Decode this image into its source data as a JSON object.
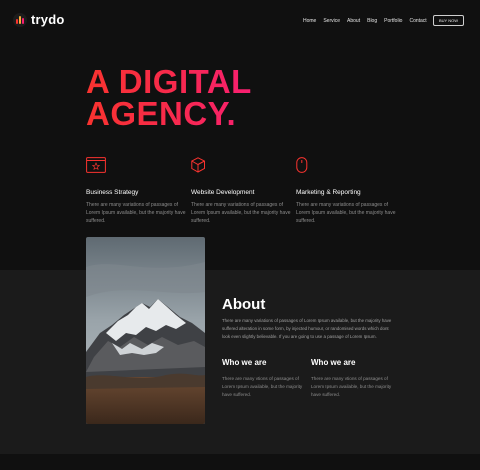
{
  "header": {
    "logo_text": "trydo",
    "nav": [
      "Home",
      "Service",
      "About",
      "Blog",
      "Portfolio",
      "Contact"
    ],
    "cta_label": "BUY NOW"
  },
  "hero": {
    "line1": "A DIGITAL",
    "line2": "AGENCY."
  },
  "services": [
    {
      "icon": "monitor-icon",
      "title": "Business Strategy",
      "text": "There are many variations of passages of Lorem Ipsum available, but the majority have suffered."
    },
    {
      "icon": "cube-icon",
      "title": "Website Development",
      "text": "There are many variations of passages of Lorem Ipsum available, but the majority have suffered."
    },
    {
      "icon": "mouse-icon",
      "title": "Marketing & Reporting",
      "text": "There are many variations of passages of Lorem Ipsum available, but the majority have suffered."
    }
  ],
  "about": {
    "title": "About",
    "text": "There are many variations of passages of Lorem Ipsum available, but the majority have suffered alteration in some form, by injected humour, or randomised words which dont look even slightly believable. If you are going to use a passage of Lorem Ipsum.",
    "who": [
      {
        "title": "Who we are",
        "text": "There are many vtions of passages of Lorem Ipsum available, but the majority have suffered."
      },
      {
        "title": "Who we are",
        "text": "There are many vtions of passages of Lorem Ipsum available, but the majority have suffered."
      }
    ]
  },
  "colors": {
    "background": "#101010",
    "band": "#1b1b1b",
    "accent_start": "#f9332f",
    "accent_end": "#f81f72"
  }
}
